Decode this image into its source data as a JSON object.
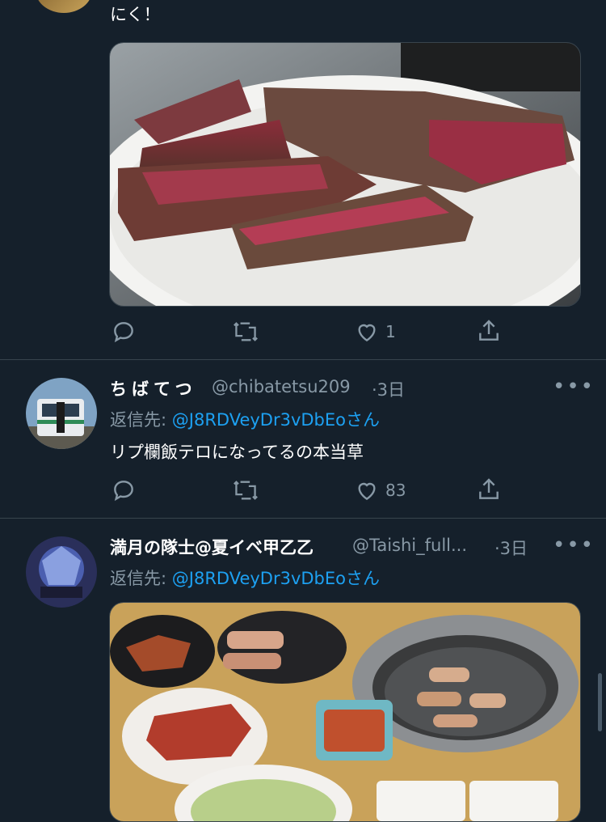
{
  "tweets": [
    {
      "text": "にく！",
      "actions": {
        "like_count": "1"
      }
    },
    {
      "display_name": "ちばてつ",
      "handle": "@chibatetsu209",
      "time": "·3日",
      "reply_prefix": "返信先:",
      "reply_to": "@J8RDVeyDr3vDbEo",
      "reply_suffix": "さん",
      "text": "リプ欄飯テロになってるの本当草",
      "actions": {
        "like_count": "83"
      }
    },
    {
      "display_name": "満月の隊士@夏イベ甲乙乙",
      "handle": "@Taishi_full...",
      "time": "·3日",
      "reply_prefix": "返信先:",
      "reply_to": "@J8RDVeyDr3vDbEo",
      "reply_suffix": "さん"
    }
  ],
  "colors": {
    "background": "#15202b",
    "secondary_text": "#8899a6",
    "link": "#1da1f2",
    "divider": "#38444d"
  },
  "icons": [
    "reply-icon",
    "retweet-icon",
    "like-icon",
    "share-icon",
    "more-icon"
  ]
}
